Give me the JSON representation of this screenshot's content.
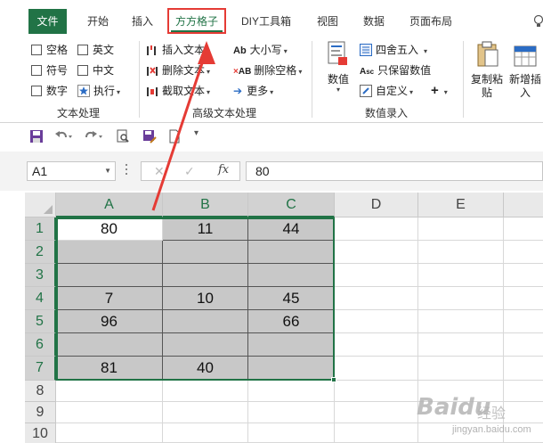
{
  "tabs": {
    "file": "文件",
    "home": "开始",
    "insert": "插入",
    "fangfang": "方方格子",
    "diy": "DIY工具箱",
    "view": "视图",
    "data": "数据",
    "page_layout": "页面布局"
  },
  "ribbon": {
    "text_group": {
      "space": "空格",
      "english": "英文",
      "symbol": "符号",
      "chinese": "中文",
      "number": "数字",
      "execute": "执行",
      "label": "文本处理"
    },
    "advanced_group": {
      "insert_text": "插入文本",
      "delete_text": "删除文本",
      "extract_text": "截取文本",
      "case": "大小写",
      "delete_space": "删除空格",
      "more": "更多",
      "label": "高级文本处理"
    },
    "value_group": {
      "number": "数值",
      "round": "四舍五入",
      "keep_value": "只保留数值",
      "custom": "自定义",
      "label": "数值录入"
    },
    "copy_paste": "复制粘贴",
    "add_insert": "新增插入"
  },
  "formula_bar": {
    "name_box": "A1",
    "fx": "fx",
    "value": "80"
  },
  "columns": [
    "A",
    "B",
    "C",
    "D",
    "E"
  ],
  "rows": [
    "1",
    "2",
    "3",
    "4",
    "5",
    "6",
    "7",
    "8",
    "9",
    "10"
  ],
  "cells": {
    "r1": [
      "80",
      "11",
      "44"
    ],
    "r2": [
      "",
      "",
      ""
    ],
    "r3": [
      "",
      "",
      ""
    ],
    "r4": [
      "7",
      "10",
      "45"
    ],
    "r5": [
      "96",
      "",
      "66"
    ],
    "r6": [
      "",
      "",
      ""
    ],
    "r7": [
      "81",
      "40",
      ""
    ]
  },
  "watermark": {
    "brand": "Baidu",
    "sub": "经验",
    "url": "jingyan.baidu.com"
  },
  "colors": {
    "accent": "#217346",
    "highlight": "#e53b35",
    "selected_fill": "#c8c8c8"
  }
}
